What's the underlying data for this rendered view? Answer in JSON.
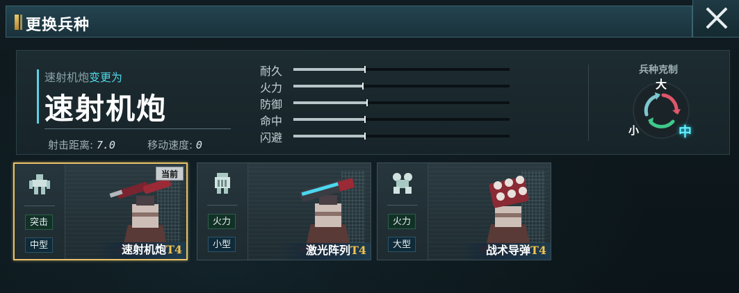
{
  "window": {
    "title": "更换兵种",
    "close_icon": "close-icon"
  },
  "info": {
    "from_unit": "速射机炮",
    "change_verb": "变更为",
    "unit_name": "速射机炮",
    "range_label": "射击距离:",
    "range_value": "7.0",
    "speed_label": "移动速度:",
    "speed_value": "0",
    "stats": [
      {
        "label": "耐久",
        "value": 0.33
      },
      {
        "label": "火力",
        "value": 0.32
      },
      {
        "label": "防御",
        "value": 0.34
      },
      {
        "label": "命中",
        "value": 0.33
      },
      {
        "label": "闪避",
        "value": 0.33
      }
    ],
    "counter": {
      "title": "兵种克制",
      "big": "大",
      "small": "小",
      "mid": "中"
    }
  },
  "cards": [
    {
      "name": "速射机炮",
      "tier": "T4",
      "role": "突击",
      "size": "中型",
      "badge": "当前",
      "icon": "assault-mech-icon"
    },
    {
      "name": "激光阵列",
      "tier": "T4",
      "role": "火力",
      "size": "小型",
      "icon": "firepower-mech-icon"
    },
    {
      "name": "战术导弹",
      "tier": "T4",
      "role": "火力",
      "size": "大型",
      "icon": "heavy-mech-icon"
    }
  ],
  "colors": {
    "accent": "#4fd6e6",
    "selected_border": "#e9c26a",
    "tier": "#f0c24e"
  }
}
